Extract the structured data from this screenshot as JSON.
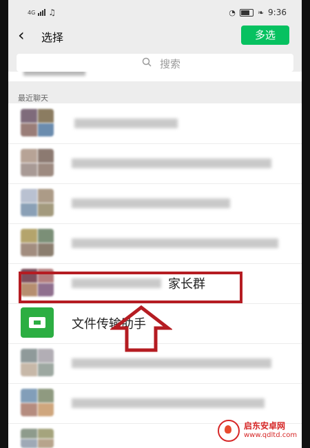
{
  "status_bar": {
    "network": "4G",
    "music_symbol": "♫",
    "battery_percent": "",
    "time": "9:36"
  },
  "header": {
    "back_icon": "chevron-left-icon",
    "title": "选择",
    "multi_select_label": "多选"
  },
  "search": {
    "placeholder": "搜索",
    "icon": "search-icon"
  },
  "section": {
    "label": "最近聊天"
  },
  "rows": [
    {
      "text": "",
      "avatar_colors": [
        "#7f6b7b",
        "#8b7c61",
        "#9a7d78",
        "#6b8cae"
      ]
    },
    {
      "text": "",
      "avatar_colors": [
        "#b7a396",
        "#8c7a71",
        "#a89a95",
        "#9d8a80"
      ]
    },
    {
      "text": "",
      "avatar_colors": [
        "#b9c1d1",
        "#ac9b87",
        "#8aa0b6",
        "#a39a7d"
      ]
    },
    {
      "text": "",
      "avatar_colors": [
        "#b4a46c",
        "#7b8f77",
        "#a28d7f",
        "#8b7e6f"
      ]
    },
    {
      "text": "家长群",
      "avatar_colors": [
        "#7d4f5c",
        "#b47d7d",
        "#b68e6f",
        "#8f6f8e"
      ]
    },
    {
      "text": "文件传输助手",
      "avatar_colors": [
        "#2cae42"
      ]
    },
    {
      "text": "",
      "avatar_colors": [
        "#8f9a9a",
        "#b2aeb5",
        "#c7b8a8",
        "#9da8a1"
      ]
    },
    {
      "text": "",
      "avatar_colors": [
        "#829eb9",
        "#8f9a80",
        "#b58c7f",
        "#cfa67d"
      ]
    }
  ],
  "watermark": {
    "brand": "启东安卓网",
    "url": "www.qdltd.com"
  }
}
